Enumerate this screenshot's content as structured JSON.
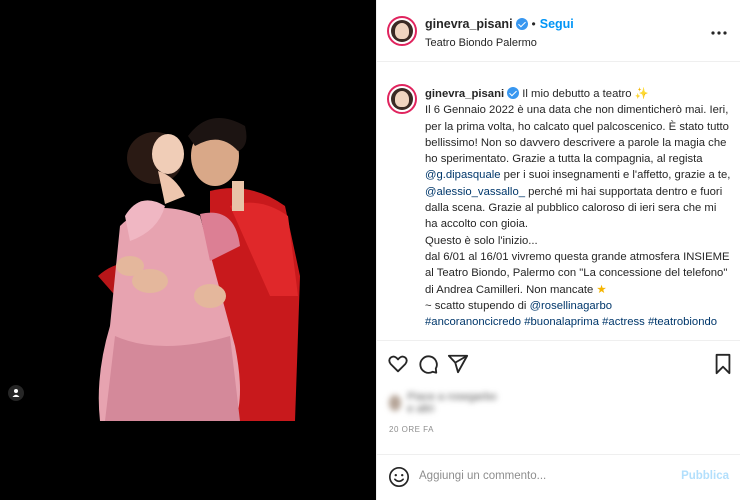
{
  "post": {
    "username": "ginevra_pisani",
    "follow_label": "Segui",
    "location": "Teatro Biondo Palermo",
    "more_label": "•••"
  },
  "caption": {
    "username": "ginevra_pisani",
    "line1": "Il mio debutto a teatro",
    "p1": "Il 6 Gennaio 2022 è una data che non dimenticherò mai. Ieri, per la prima volta, ho calcato quel palcoscenico. È stato tutto bellissimo! Non so davvero descrivere a parole la magia che ho sperimentato. Grazie a tutta la compagnia, al regista ",
    "mention1": "@g.dipasquale",
    "p2": " per i suoi insegnamenti e l'affetto, grazie a te, ",
    "mention2": "@alessio_vassallo_",
    "p3": " perché mi hai supportata dentro e fuori dalla scena. Grazie al pubblico caloroso di ieri sera che mi ha accolto con gioia.",
    "p4": "Questo è solo l'inizio...",
    "p5": "dal 6/01 al 16/01 vivremo questa grande atmosfera INSIEME al Teatro Biondo, Palermo con \"La concessione del telefono\" di Andrea Camilleri. Non mancate",
    "p6": "~ scatto stupendo di ",
    "mention3": "@rosellinagarbo",
    "hashtags": [
      "#ancoranoncicredo",
      "#buonalaprima",
      "#actress",
      "#teatrobiondo"
    ]
  },
  "likes_blurred": "Piace a rosegarbo e altri",
  "timestamp": "20 ORE FA",
  "comment": {
    "placeholder": "Aggiungi un commento...",
    "publish_label": "Pubblica"
  },
  "icons": [
    "tag-user-icon",
    "verified-icon",
    "more-icon",
    "heart-icon",
    "comment-icon",
    "share-icon",
    "bookmark-icon",
    "emoji-icon",
    "sparkle-emoji",
    "star-emoji"
  ],
  "colors": {
    "follow": "#0095f6",
    "mention": "#00376b",
    "publish": "#b2dffc",
    "verified": "#3897f0"
  }
}
